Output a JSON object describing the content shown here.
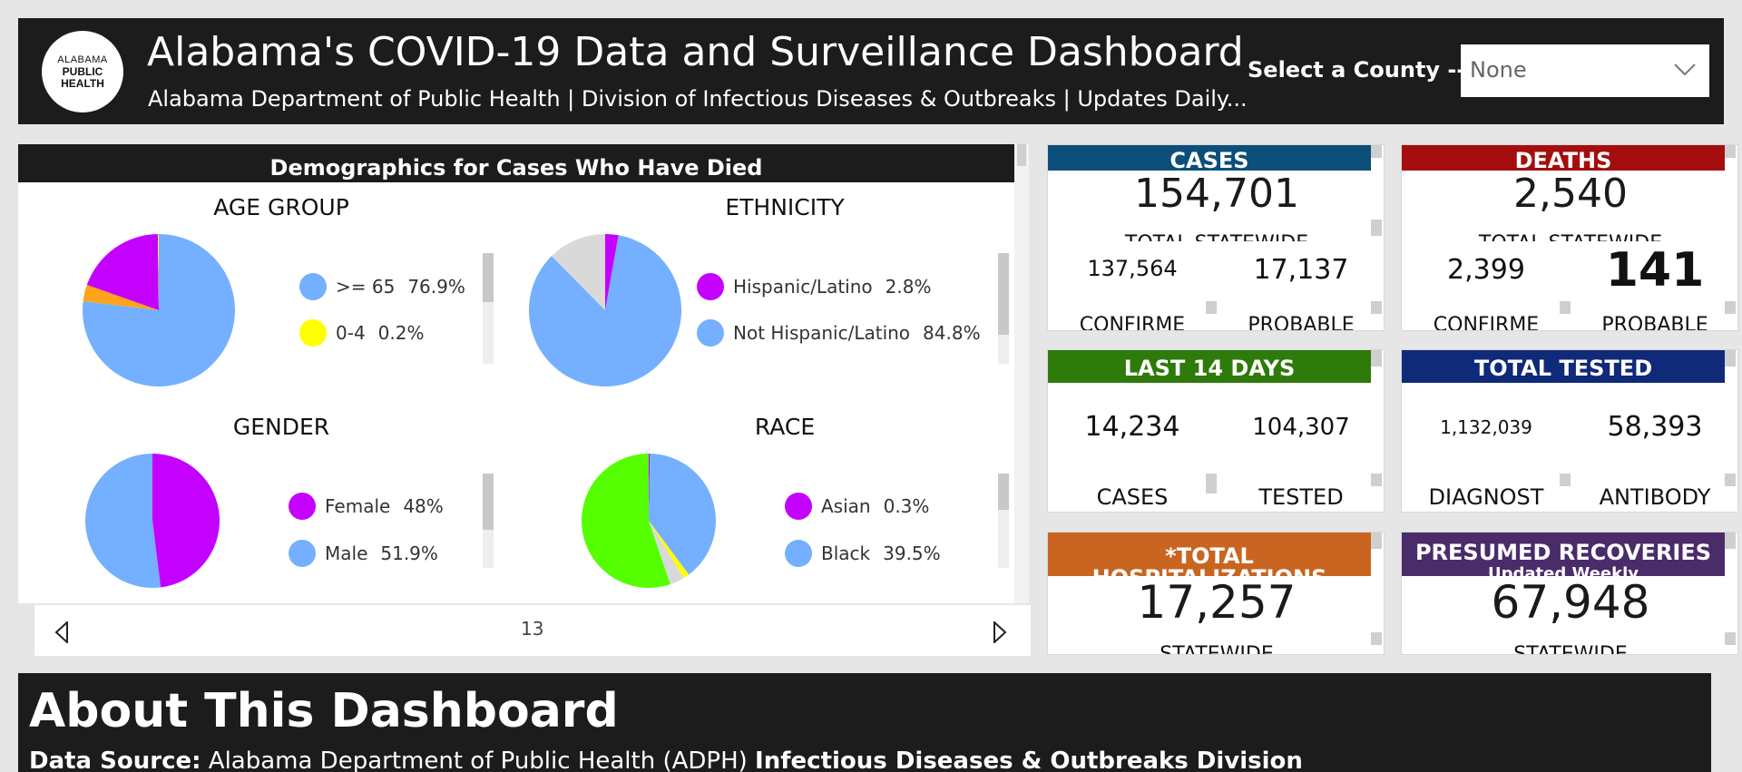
{
  "header": {
    "logo_lines": [
      "ALABAMA",
      "PUBLIC",
      "HEALTH"
    ],
    "title": "Alabama's COVID-19 Data and Surveillance Dashboard",
    "subtitle": "Alabama Department of Public Health | Division of Infectious Diseases & Outbreaks | Updates Daily...",
    "county_label": "Select a County -->",
    "county_value": "None"
  },
  "demographics": {
    "title": "Demographics for Cases Who Have Died",
    "page_number": "13",
    "charts": [
      {
        "id": "age",
        "title": "AGE GROUP",
        "slices": [
          {
            "label": ">= 65",
            "value": 76.9,
            "color": "#74b0ff"
          },
          {
            "label": "",
            "value": 3.5,
            "color": "#ffa31a"
          },
          {
            "label": "",
            "value": 19.4,
            "color": "#c400ff"
          },
          {
            "label": "0-4",
            "value": 0.2,
            "color": "#ffff00"
          }
        ],
        "legend": [
          {
            "label": ">= 65",
            "value": "76.9%",
            "color": "#74b0ff"
          },
          {
            "label": "0-4",
            "value": "0.2%",
            "color": "#ffff00"
          }
        ]
      },
      {
        "id": "ethnicity",
        "title": "ETHNICITY",
        "slices": [
          {
            "label": "Hispanic/Latino",
            "value": 2.8,
            "color": "#c400ff"
          },
          {
            "label": "Not Hispanic/Latino",
            "value": 84.8,
            "color": "#74b0ff"
          },
          {
            "label": "",
            "value": 12.4,
            "color": "#d9d9d9"
          }
        ],
        "legend": [
          {
            "label": "Hispanic/Latino",
            "value": "2.8%",
            "color": "#c400ff"
          },
          {
            "label": "Not Hispanic/Latino",
            "value": "84.8%",
            "color": "#74b0ff"
          }
        ]
      },
      {
        "id": "gender",
        "title": "GENDER",
        "slices": [
          {
            "label": "Female",
            "value": 48,
            "color": "#c400ff"
          },
          {
            "label": "Male",
            "value": 51.9,
            "color": "#74b0ff"
          }
        ],
        "legend": [
          {
            "label": "Female",
            "value": "48%",
            "color": "#c400ff"
          },
          {
            "label": "Male",
            "value": "51.9%",
            "color": "#74b0ff"
          }
        ]
      },
      {
        "id": "race",
        "title": "RACE",
        "slices": [
          {
            "label": "Asian",
            "value": 0.3,
            "color": "#c400ff"
          },
          {
            "label": "Black",
            "value": 39.5,
            "color": "#74b0ff"
          },
          {
            "label": "",
            "value": 1.5,
            "color": "#ffff00"
          },
          {
            "label": "",
            "value": 3.5,
            "color": "#d9d9d9"
          },
          {
            "label": "",
            "value": 55.2,
            "color": "#55ff00"
          }
        ],
        "legend": [
          {
            "label": "Asian",
            "value": "0.3%",
            "color": "#c400ff"
          },
          {
            "label": "Black",
            "value": "39.5%",
            "color": "#74b0ff"
          }
        ]
      }
    ]
  },
  "cards": {
    "cases": {
      "head": "CASES",
      "color": "#0b4f7a",
      "total": "154,701",
      "total_caption": "TOTAL STATEWIDE",
      "left_value": "137,564",
      "left_caption": "CONFIRME",
      "right_value": "17,137",
      "right_caption": "PROBABLE"
    },
    "deaths": {
      "head": "DEATHS",
      "color": "#a50e0e",
      "total": "2,540",
      "total_caption": "TOTAL STATEWIDE",
      "left_value": "2,399",
      "left_caption": "CONFIRME",
      "right_value": "141",
      "right_caption": "PROBABLE"
    },
    "last14": {
      "head": "LAST 14 DAYS",
      "color": "#2e7a0a",
      "left_value": "14,234",
      "left_caption": "CASES",
      "right_value": "104,307",
      "right_caption": "TESTED"
    },
    "tested": {
      "head": "TOTAL TESTED",
      "color": "#0f2a78",
      "left_value": "1,132,039",
      "left_caption": "DIAGNOST",
      "right_value": "58,393",
      "right_caption": "ANTIBODY"
    },
    "hosp": {
      "head": "*TOTAL",
      "head_sub": "HOSPITALIZATIONS",
      "color": "#c96520",
      "total": "17,257",
      "total_caption": "STATEWIDE"
    },
    "recov": {
      "head": "PRESUMED RECOVERIES",
      "head_sub": "Updated Weekly",
      "color": "#4a2c6a",
      "total": "67,948",
      "total_caption": "STATEWIDE"
    }
  },
  "about": {
    "title": "About This Dashboard",
    "source_label": "Data Source:",
    "source_text": " Alabama Department of Public Health (ADPH) ",
    "source_division": "Infectious Diseases & Outbreaks Division"
  }
}
